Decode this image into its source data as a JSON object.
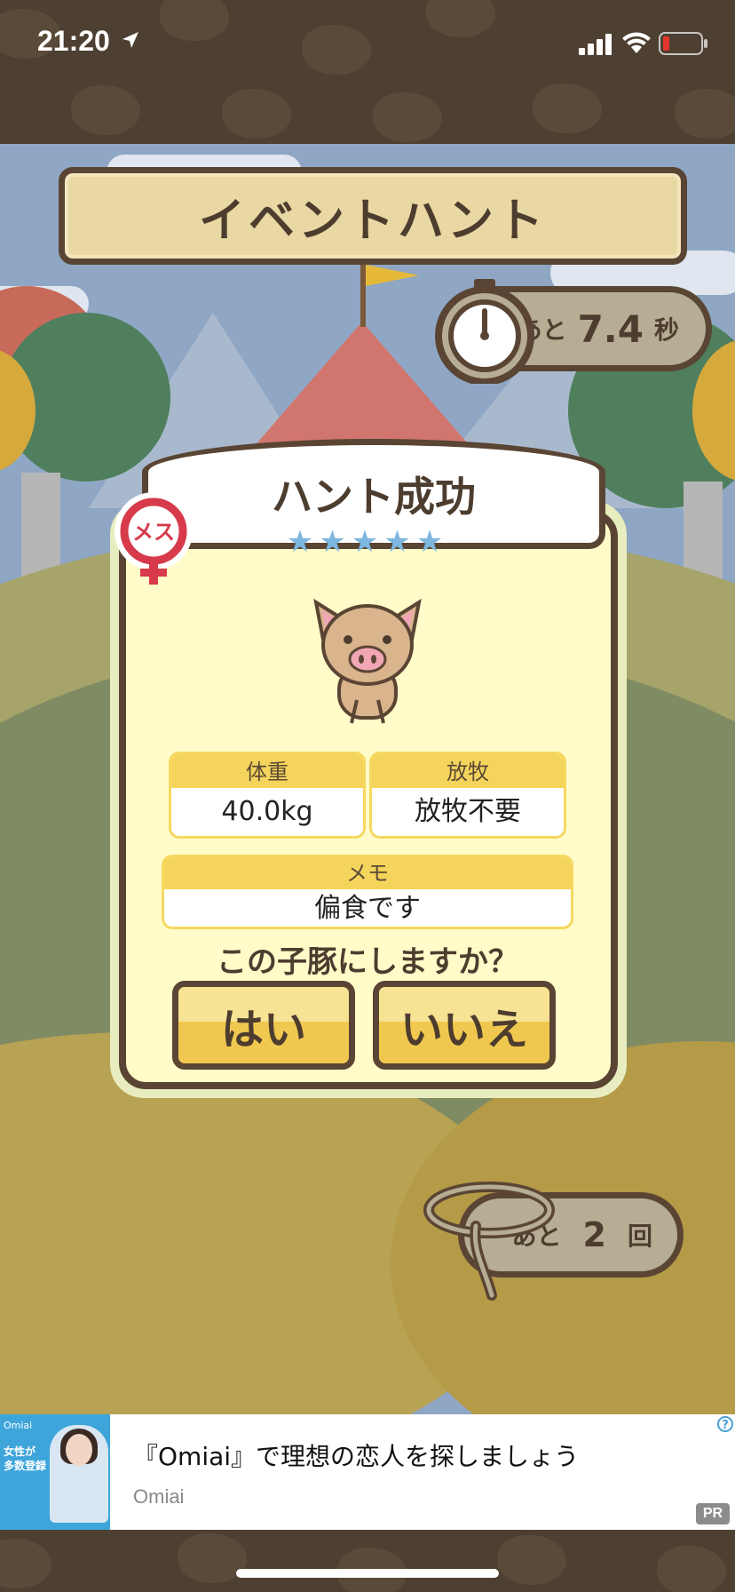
{
  "status_bar": {
    "time": "21:20"
  },
  "game": {
    "title": "イベントハント",
    "timer": {
      "prefix": "あと",
      "value": "7.4",
      "suffix": "秒"
    },
    "result_banner": "ハント成功",
    "stars": "★★★★★",
    "gender_badge": "メス",
    "stats": {
      "weight": {
        "label": "体重",
        "value": "40.0kg"
      },
      "grazing": {
        "label": "放牧",
        "value": "放牧不要"
      },
      "memo": {
        "label": "メモ",
        "value": "偏食です"
      }
    },
    "question": "この子豚にしますか？",
    "yes_label": "はい",
    "no_label": "いいえ",
    "remaining": {
      "prefix": "あと",
      "value": "2",
      "suffix": "回"
    }
  },
  "ad": {
    "title": "『Omiai』で理想の恋人を探しましょう",
    "source": "Omiai",
    "help": "?",
    "pr": "PR",
    "thumb_brand": "Omiai",
    "thumb_copy": "女性が 多数登録"
  },
  "colors": {
    "brown_outline": "#5a4534",
    "panel": "#fffcc9",
    "button": "#f1c84f",
    "star": "#7db6de",
    "badge": "#d73a4a"
  }
}
